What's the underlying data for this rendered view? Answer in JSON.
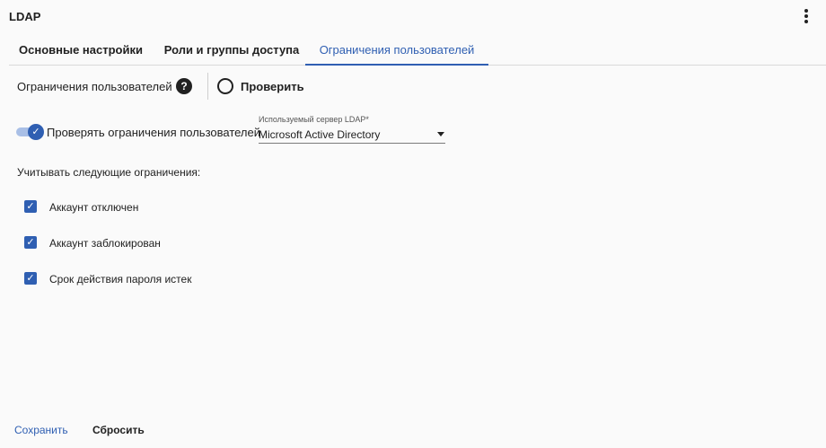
{
  "header": {
    "title": "LDAP",
    "menu_icon": "kebab-menu-icon"
  },
  "tabs": [
    {
      "label": "Основные настройки",
      "active": false
    },
    {
      "label": "Роли и группы доступа",
      "active": false
    },
    {
      "label": "Ограничения пользователей",
      "active": true
    }
  ],
  "section": {
    "title": "Ограничения пользователей",
    "help_icon": "question-circle-icon",
    "check_label": "Проверить"
  },
  "toggle": {
    "label": "Проверять ограничения пользователей",
    "checked": true
  },
  "ldap_server": {
    "caption": "Используемый сервер LDAP*",
    "value": "Microsoft Active Directory"
  },
  "restrictions": {
    "title": "Учитывать следующие ограничения:",
    "items": [
      {
        "label": "Аккаунт отключен",
        "checked": true
      },
      {
        "label": "Аккаунт заблокирован",
        "checked": true
      },
      {
        "label": "Срок действия пароля истек",
        "checked": true
      }
    ]
  },
  "footer": {
    "save_label": "Сохранить",
    "reset_label": "Сбросить"
  },
  "colors": {
    "accent": "#2f5fb2",
    "text": "#212121",
    "background": "#fafafa"
  }
}
